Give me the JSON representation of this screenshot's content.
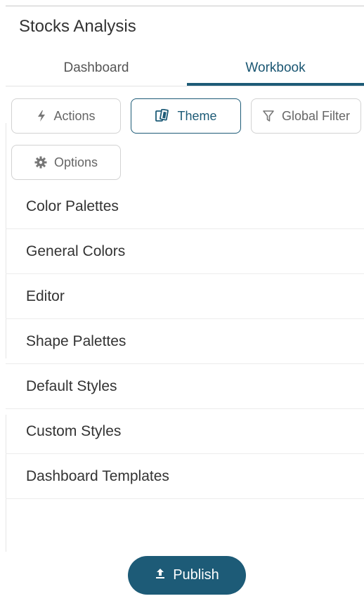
{
  "app": {
    "title": "Stocks Analysis"
  },
  "tabs": [
    {
      "label": "Dashboard",
      "active": false
    },
    {
      "label": "Workbook",
      "active": true
    }
  ],
  "toolbar": {
    "actions_label": "Actions",
    "theme_label": "Theme",
    "global_filter_label": "Global Filter",
    "options_label": "Options"
  },
  "menu": [
    {
      "label": "Color Palettes"
    },
    {
      "label": "General Colors"
    },
    {
      "label": "Editor"
    },
    {
      "label": "Shape Palettes"
    },
    {
      "label": "Default Styles"
    },
    {
      "label": "Custom Styles"
    },
    {
      "label": "Dashboard Templates"
    }
  ],
  "publish": {
    "label": "Publish"
  },
  "icons": {
    "actions": "lightning-icon",
    "theme": "theme-icon",
    "global_filter": "filter-icon",
    "options": "gear-icon",
    "publish": "upload-icon"
  },
  "colors": {
    "accent": "#1d5b77",
    "text": "#333333",
    "muted": "#666666"
  }
}
